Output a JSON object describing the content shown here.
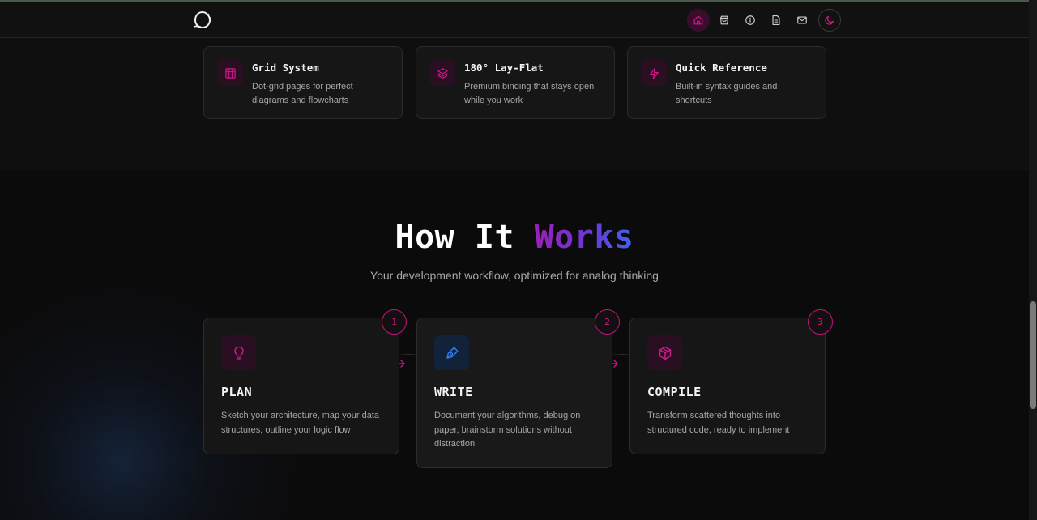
{
  "navbar": {
    "logo": "logo-icon",
    "items": [
      {
        "icon": "home-icon",
        "active": true
      },
      {
        "icon": "shopping-bag-icon",
        "active": false
      },
      {
        "icon": "info-icon",
        "active": false
      },
      {
        "icon": "document-icon",
        "active": false
      },
      {
        "icon": "mail-icon",
        "active": false
      }
    ],
    "theme_toggle": "moon-icon"
  },
  "features": [
    {
      "title": "Grid System",
      "description": "Dot-grid pages for perfect diagrams and flowcharts",
      "icon": "grid-icon"
    },
    {
      "title": "180° Lay-Flat",
      "description": "Premium binding that stays open while you work",
      "icon": "layers-icon"
    },
    {
      "title": "Quick Reference",
      "description": "Built-in syntax guides and shortcuts",
      "icon": "lightning-icon"
    }
  ],
  "how": {
    "title_plain": "How It ",
    "title_highlight": "Works",
    "subtitle": "Your development workflow, optimized for analog thinking"
  },
  "steps": [
    {
      "number": "1",
      "title": "PLAN",
      "description": "Sketch your architecture, map your data structures, outline your logic flow",
      "icon": "lightbulb-icon"
    },
    {
      "number": "2",
      "title": "WRITE",
      "description": "Document your algorithms, debug on paper, brainstorm solutions without distraction",
      "icon": "pen-icon"
    },
    {
      "number": "3",
      "title": "COMPILE",
      "description": "Transform scattered thoughts into structured code, ready to implement",
      "icon": "cube-icon"
    }
  ],
  "colors": {
    "accent": "#d01987",
    "accent_bg": "#2a0f23",
    "blue_accent": "#2f7be8",
    "background": "#0e0e0f",
    "card": "#161617"
  }
}
